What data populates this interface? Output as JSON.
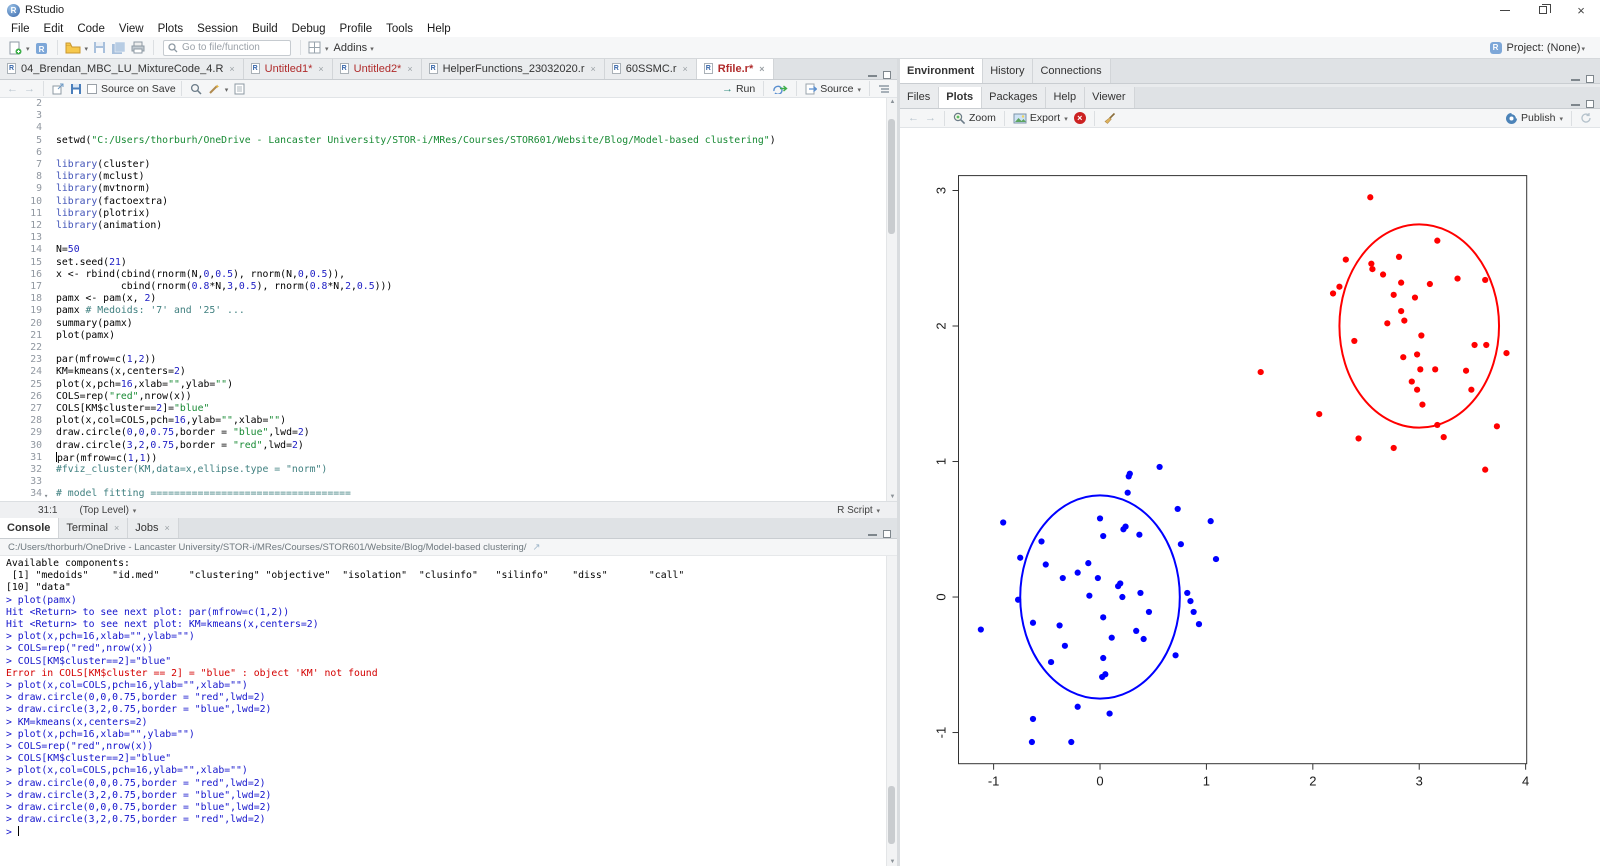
{
  "window": {
    "title": "RStudio",
    "project_selector": "Project: (None)"
  },
  "menu": [
    "File",
    "Edit",
    "Code",
    "View",
    "Plots",
    "Session",
    "Build",
    "Debug",
    "Profile",
    "Tools",
    "Help"
  ],
  "toolbar": {
    "goto_placeholder": "Go to file/function",
    "addins_label": "Addins"
  },
  "source_pane": {
    "tabs": [
      {
        "label": "04_Brendan_MBC_LU_MixtureCode_4.R",
        "modified": false,
        "active": false
      },
      {
        "label": "Untitled1*",
        "modified": true,
        "active": false
      },
      {
        "label": "Untitled2*",
        "modified": true,
        "active": false
      },
      {
        "label": "HelperFunctions_23032020.r",
        "modified": false,
        "active": false
      },
      {
        "label": "60SSMC.r",
        "modified": false,
        "active": false
      },
      {
        "label": "Rfile.r*",
        "modified": true,
        "active": true
      }
    ],
    "toolbar": {
      "source_on_save": "Source on Save",
      "run_label": "Run",
      "source_label": "Source"
    },
    "status": {
      "position": "31:1",
      "scope": "(Top Level)",
      "file_type": "R Script"
    },
    "cursor_line": 31,
    "lines": [
      {
        "n": 2,
        "s": []
      },
      {
        "n": 3,
        "s": []
      },
      {
        "n": 4,
        "s": []
      },
      {
        "n": 5,
        "s": [
          {
            "t": "setwd("
          },
          {
            "t": "\"C:/Users/thorburh/OneDrive - Lancaster University/STOR-i/MRes/Courses/STOR601/Website/Blog/Model-based clustering\"",
            "c": "s"
          },
          {
            "t": ")"
          }
        ]
      },
      {
        "n": 6,
        "s": []
      },
      {
        "n": 7,
        "s": [
          {
            "t": "library",
            "c": "k"
          },
          {
            "t": "(cluster)"
          }
        ]
      },
      {
        "n": 8,
        "s": [
          {
            "t": "library",
            "c": "k"
          },
          {
            "t": "(mclust)"
          }
        ]
      },
      {
        "n": 9,
        "s": [
          {
            "t": "library",
            "c": "k"
          },
          {
            "t": "(mvtnorm)"
          }
        ]
      },
      {
        "n": 10,
        "s": [
          {
            "t": "library",
            "c": "k"
          },
          {
            "t": "(factoextra)"
          }
        ]
      },
      {
        "n": 11,
        "s": [
          {
            "t": "library",
            "c": "k"
          },
          {
            "t": "(plotrix)"
          }
        ]
      },
      {
        "n": 12,
        "s": [
          {
            "t": "library",
            "c": "k"
          },
          {
            "t": "(animation)"
          }
        ]
      },
      {
        "n": 13,
        "s": []
      },
      {
        "n": 14,
        "s": [
          {
            "t": "N="
          },
          {
            "t": "50",
            "c": "n"
          }
        ]
      },
      {
        "n": 15,
        "s": [
          {
            "t": "set.seed("
          },
          {
            "t": "21",
            "c": "n"
          },
          {
            "t": ")"
          }
        ]
      },
      {
        "n": 16,
        "s": [
          {
            "t": "x <- rbind(cbind(rnorm(N,"
          },
          {
            "t": "0",
            "c": "n"
          },
          {
            "t": ","
          },
          {
            "t": "0.5",
            "c": "n"
          },
          {
            "t": "), rnorm(N,"
          },
          {
            "t": "0",
            "c": "n"
          },
          {
            "t": ","
          },
          {
            "t": "0.5",
            "c": "n"
          },
          {
            "t": ")),"
          }
        ]
      },
      {
        "n": 17,
        "s": [
          {
            "t": "           cbind(rnorm("
          },
          {
            "t": "0.8",
            "c": "n"
          },
          {
            "t": "*N,"
          },
          {
            "t": "3",
            "c": "n"
          },
          {
            "t": ","
          },
          {
            "t": "0.5",
            "c": "n"
          },
          {
            "t": "), rnorm("
          },
          {
            "t": "0.8",
            "c": "n"
          },
          {
            "t": "*N,"
          },
          {
            "t": "2",
            "c": "n"
          },
          {
            "t": ","
          },
          {
            "t": "0.5",
            "c": "n"
          },
          {
            "t": ")))"
          }
        ]
      },
      {
        "n": 18,
        "s": [
          {
            "t": "pamx <- pam(x, "
          },
          {
            "t": "2",
            "c": "n"
          },
          {
            "t": ")"
          }
        ]
      },
      {
        "n": 19,
        "s": [
          {
            "t": "pamx "
          },
          {
            "t": "# Medoids: '7' and '25' ...",
            "c": "m"
          }
        ]
      },
      {
        "n": 20,
        "s": [
          {
            "t": "summary(pamx)"
          }
        ]
      },
      {
        "n": 21,
        "s": [
          {
            "t": "plot(pamx)"
          }
        ]
      },
      {
        "n": 22,
        "s": []
      },
      {
        "n": 23,
        "s": [
          {
            "t": "par(mfrow=c("
          },
          {
            "t": "1",
            "c": "n"
          },
          {
            "t": ","
          },
          {
            "t": "2",
            "c": "n"
          },
          {
            "t": "))"
          }
        ]
      },
      {
        "n": 24,
        "s": [
          {
            "t": "KM=kmeans(x,centers="
          },
          {
            "t": "2",
            "c": "n"
          },
          {
            "t": ")"
          }
        ]
      },
      {
        "n": 25,
        "s": [
          {
            "t": "plot(x,pch="
          },
          {
            "t": "16",
            "c": "n"
          },
          {
            "t": ",xlab="
          },
          {
            "t": "\"\"",
            "c": "s"
          },
          {
            "t": ",ylab="
          },
          {
            "t": "\"\"",
            "c": "s"
          },
          {
            "t": ")"
          }
        ]
      },
      {
        "n": 26,
        "s": [
          {
            "t": "COLS=rep("
          },
          {
            "t": "\"red\"",
            "c": "s"
          },
          {
            "t": ",nrow(x))"
          }
        ]
      },
      {
        "n": 27,
        "s": [
          {
            "t": "COLS[KM$cluster=="
          },
          {
            "t": "2",
            "c": "n"
          },
          {
            "t": "]="
          },
          {
            "t": "\"blue\"",
            "c": "s"
          }
        ]
      },
      {
        "n": 28,
        "s": [
          {
            "t": "plot(x,col=COLS,pch="
          },
          {
            "t": "16",
            "c": "n"
          },
          {
            "t": ",ylab="
          },
          {
            "t": "\"\"",
            "c": "s"
          },
          {
            "t": ",xlab="
          },
          {
            "t": "\"\"",
            "c": "s"
          },
          {
            "t": ")"
          }
        ]
      },
      {
        "n": 29,
        "s": [
          {
            "t": "draw.circle("
          },
          {
            "t": "0",
            "c": "n"
          },
          {
            "t": ","
          },
          {
            "t": "0",
            "c": "n"
          },
          {
            "t": ","
          },
          {
            "t": "0.75",
            "c": "n"
          },
          {
            "t": ",border = "
          },
          {
            "t": "\"blue\"",
            "c": "s"
          },
          {
            "t": ",lwd="
          },
          {
            "t": "2",
            "c": "n"
          },
          {
            "t": ")"
          }
        ]
      },
      {
        "n": 30,
        "s": [
          {
            "t": "draw.circle("
          },
          {
            "t": "3",
            "c": "n"
          },
          {
            "t": ","
          },
          {
            "t": "2",
            "c": "n"
          },
          {
            "t": ","
          },
          {
            "t": "0.75",
            "c": "n"
          },
          {
            "t": ",border = "
          },
          {
            "t": "\"red\"",
            "c": "s"
          },
          {
            "t": ",lwd="
          },
          {
            "t": "2",
            "c": "n"
          },
          {
            "t": ")"
          }
        ]
      },
      {
        "n": 31,
        "s": [
          {
            "t": "par(mfrow=c("
          },
          {
            "t": "1",
            "c": "n"
          },
          {
            "t": ","
          },
          {
            "t": "1",
            "c": "n"
          },
          {
            "t": "))"
          }
        ]
      },
      {
        "n": 32,
        "s": [
          {
            "t": "#fviz_cluster(KM,data=x,ellipse.type = \"norm\")",
            "c": "m"
          }
        ]
      },
      {
        "n": 33,
        "s": []
      },
      {
        "n": 34,
        "fold": true,
        "s": [
          {
            "t": "# model fitting ==================================",
            "c": "m"
          }
        ]
      }
    ]
  },
  "console_pane": {
    "tabs": [
      {
        "label": "Console",
        "active": true,
        "closable": false
      },
      {
        "label": "Terminal",
        "active": false,
        "closable": true
      },
      {
        "label": "Jobs",
        "active": false,
        "closable": true
      }
    ],
    "working_dir": "C:/Users/thorburh/OneDrive - Lancaster University/STOR-i/MRes/Courses/STOR601/Website/Blog/Model-based clustering/",
    "lines": [
      {
        "k": "o",
        "t": "Available components:"
      },
      {
        "k": "o",
        "t": " [1] \"medoids\"    \"id.med\"     \"clustering\" \"objective\"  \"isolation\"  \"clusinfo\"   \"silinfo\"    \"diss\"       \"call\""
      },
      {
        "k": "o",
        "t": "[10] \"data\""
      },
      {
        "k": "i",
        "t": "> plot(pamx)"
      },
      {
        "k": "m",
        "t": "Hit <Return> to see next plot: par(mfrow=c(1,2))"
      },
      {
        "k": "m",
        "t": "Hit <Return> to see next plot: KM=kmeans(x,centers=2)"
      },
      {
        "k": "i",
        "t": "> plot(x,pch=16,xlab=\"\",ylab=\"\")"
      },
      {
        "k": "i",
        "t": "> COLS=rep(\"red\",nrow(x))"
      },
      {
        "k": "i",
        "t": "> COLS[KM$cluster==2]=\"blue\""
      },
      {
        "k": "e",
        "t": "Error in COLS[KM$cluster == 2] = \"blue\" : object 'KM' not found"
      },
      {
        "k": "i",
        "t": "> plot(x,col=COLS,pch=16,ylab=\"\",xlab=\"\")"
      },
      {
        "k": "i",
        "t": "> draw.circle(0,0,0.75,border = \"red\",lwd=2)"
      },
      {
        "k": "i",
        "t": "> draw.circle(3,2,0.75,border = \"blue\",lwd=2)"
      },
      {
        "k": "i",
        "t": "> KM=kmeans(x,centers=2)"
      },
      {
        "k": "i",
        "t": "> plot(x,pch=16,xlab=\"\",ylab=\"\")"
      },
      {
        "k": "i",
        "t": "> COLS=rep(\"red\",nrow(x))"
      },
      {
        "k": "i",
        "t": "> COLS[KM$cluster==2]=\"blue\""
      },
      {
        "k": "i",
        "t": "> plot(x,col=COLS,pch=16,ylab=\"\",xlab=\"\")"
      },
      {
        "k": "i",
        "t": "> draw.circle(0,0,0.75,border = \"red\",lwd=2)"
      },
      {
        "k": "i",
        "t": "> draw.circle(3,2,0.75,border = \"blue\",lwd=2)"
      },
      {
        "k": "i",
        "t": "> draw.circle(0,0,0.75,border = \"blue\",lwd=2)"
      },
      {
        "k": "i",
        "t": "> draw.circle(3,2,0.75,border = \"red\",lwd=2)"
      },
      {
        "k": "p",
        "t": "> "
      }
    ]
  },
  "environment_pane": {
    "tabs": [
      {
        "label": "Environment",
        "active": true
      },
      {
        "label": "History",
        "active": false
      },
      {
        "label": "Connections",
        "active": false
      }
    ]
  },
  "files_pane": {
    "tabs": [
      {
        "label": "Files",
        "active": false
      },
      {
        "label": "Plots",
        "active": true
      },
      {
        "label": "Packages",
        "active": false
      },
      {
        "label": "Help",
        "active": false
      },
      {
        "label": "Viewer",
        "active": false
      }
    ],
    "toolbar": {
      "zoom_label": "Zoom",
      "export_label": "Export",
      "publish_label": "Publish"
    }
  },
  "chart_data": {
    "type": "scatter",
    "title": "",
    "xlabel": "",
    "ylabel": "",
    "xlim": [
      -1.33,
      4.01
    ],
    "ylim": [
      -1.23,
      3.11
    ],
    "x_ticks": [
      -1,
      0,
      1,
      2,
      3,
      4
    ],
    "y_ticks": [
      -1,
      0,
      1,
      2,
      3
    ],
    "grid": false,
    "legend": "none",
    "series": [
      {
        "name": "kmeans-cluster-red",
        "color": "#FF0000",
        "marker": "filled-circle",
        "points": [
          [
            2.54,
            2.95
          ],
          [
            3.17,
            2.63
          ],
          [
            2.31,
            2.49
          ],
          [
            2.81,
            2.51
          ],
          [
            2.55,
            2.46
          ],
          [
            2.56,
            2.42
          ],
          [
            2.66,
            2.38
          ],
          [
            3.62,
            2.34
          ],
          [
            3.36,
            2.35
          ],
          [
            2.83,
            2.32
          ],
          [
            3.1,
            2.31
          ],
          [
            2.25,
            2.29
          ],
          [
            2.19,
            2.24
          ],
          [
            2.76,
            2.23
          ],
          [
            2.96,
            2.21
          ],
          [
            2.83,
            2.11
          ],
          [
            2.7,
            2.02
          ],
          [
            2.86,
            2.04
          ],
          [
            3.02,
            1.93
          ],
          [
            2.39,
            1.89
          ],
          [
            3.52,
            1.86
          ],
          [
            3.63,
            1.86
          ],
          [
            2.85,
            1.77
          ],
          [
            2.98,
            1.79
          ],
          [
            3.82,
            1.8
          ],
          [
            3.01,
            1.68
          ],
          [
            3.15,
            1.68
          ],
          [
            1.51,
            1.66
          ],
          [
            3.44,
            1.67
          ],
          [
            2.93,
            1.59
          ],
          [
            2.98,
            1.53
          ],
          [
            3.49,
            1.53
          ],
          [
            3.03,
            1.42
          ],
          [
            2.06,
            1.35
          ],
          [
            3.17,
            1.27
          ],
          [
            3.73,
            1.26
          ],
          [
            3.23,
            1.18
          ],
          [
            2.43,
            1.17
          ],
          [
            2.76,
            1.1
          ],
          [
            3.62,
            0.94
          ]
        ]
      },
      {
        "name": "kmeans-cluster-blue",
        "color": "#0000FF",
        "marker": "filled-circle",
        "points": [
          [
            0.56,
            0.96
          ],
          [
            0.27,
            0.89
          ],
          [
            0.28,
            0.91
          ],
          [
            0.26,
            0.77
          ],
          [
            0.73,
            0.65
          ],
          [
            -0.91,
            0.55
          ],
          [
            0.0,
            0.58
          ],
          [
            0.22,
            0.5
          ],
          [
            1.04,
            0.56
          ],
          [
            0.37,
            0.46
          ],
          [
            -0.55,
            0.41
          ],
          [
            0.03,
            0.45
          ],
          [
            0.76,
            0.39
          ],
          [
            -0.75,
            0.29
          ],
          [
            1.09,
            0.28
          ],
          [
            -0.51,
            0.24
          ],
          [
            -0.11,
            0.25
          ],
          [
            -0.21,
            0.18
          ],
          [
            -0.35,
            0.14
          ],
          [
            -0.02,
            0.14
          ],
          [
            0.19,
            0.1
          ],
          [
            0.17,
            0.08
          ],
          [
            0.38,
            0.03
          ],
          [
            -0.1,
            0.01
          ],
          [
            0.21,
            0.0
          ],
          [
            0.82,
            0.03
          ],
          [
            -0.77,
            -0.02
          ],
          [
            0.85,
            -0.03
          ],
          [
            0.46,
            -0.11
          ],
          [
            0.88,
            -0.11
          ],
          [
            0.03,
            -0.15
          ],
          [
            -0.63,
            -0.19
          ],
          [
            0.93,
            -0.2
          ],
          [
            -0.38,
            -0.21
          ],
          [
            -1.12,
            -0.24
          ],
          [
            0.34,
            -0.25
          ],
          [
            0.11,
            -0.3
          ],
          [
            0.41,
            -0.31
          ],
          [
            -0.33,
            -0.36
          ],
          [
            -0.46,
            -0.48
          ],
          [
            0.71,
            -0.43
          ],
          [
            0.03,
            -0.45
          ],
          [
            0.02,
            -0.59
          ],
          [
            0.05,
            -0.57
          ],
          [
            -0.21,
            -0.81
          ],
          [
            0.09,
            -0.86
          ],
          [
            -0.63,
            -0.9
          ],
          [
            -0.64,
            -1.07
          ],
          [
            -0.27,
            -1.07
          ],
          [
            0.24,
            0.52
          ]
        ]
      }
    ],
    "annotations": [
      {
        "type": "circle",
        "cx": 0,
        "cy": 0,
        "r": 0.75,
        "color": "#0000FF",
        "lwd": 2
      },
      {
        "type": "circle",
        "cx": 3,
        "cy": 2,
        "r": 0.75,
        "color": "#FF0000",
        "lwd": 2
      }
    ]
  }
}
